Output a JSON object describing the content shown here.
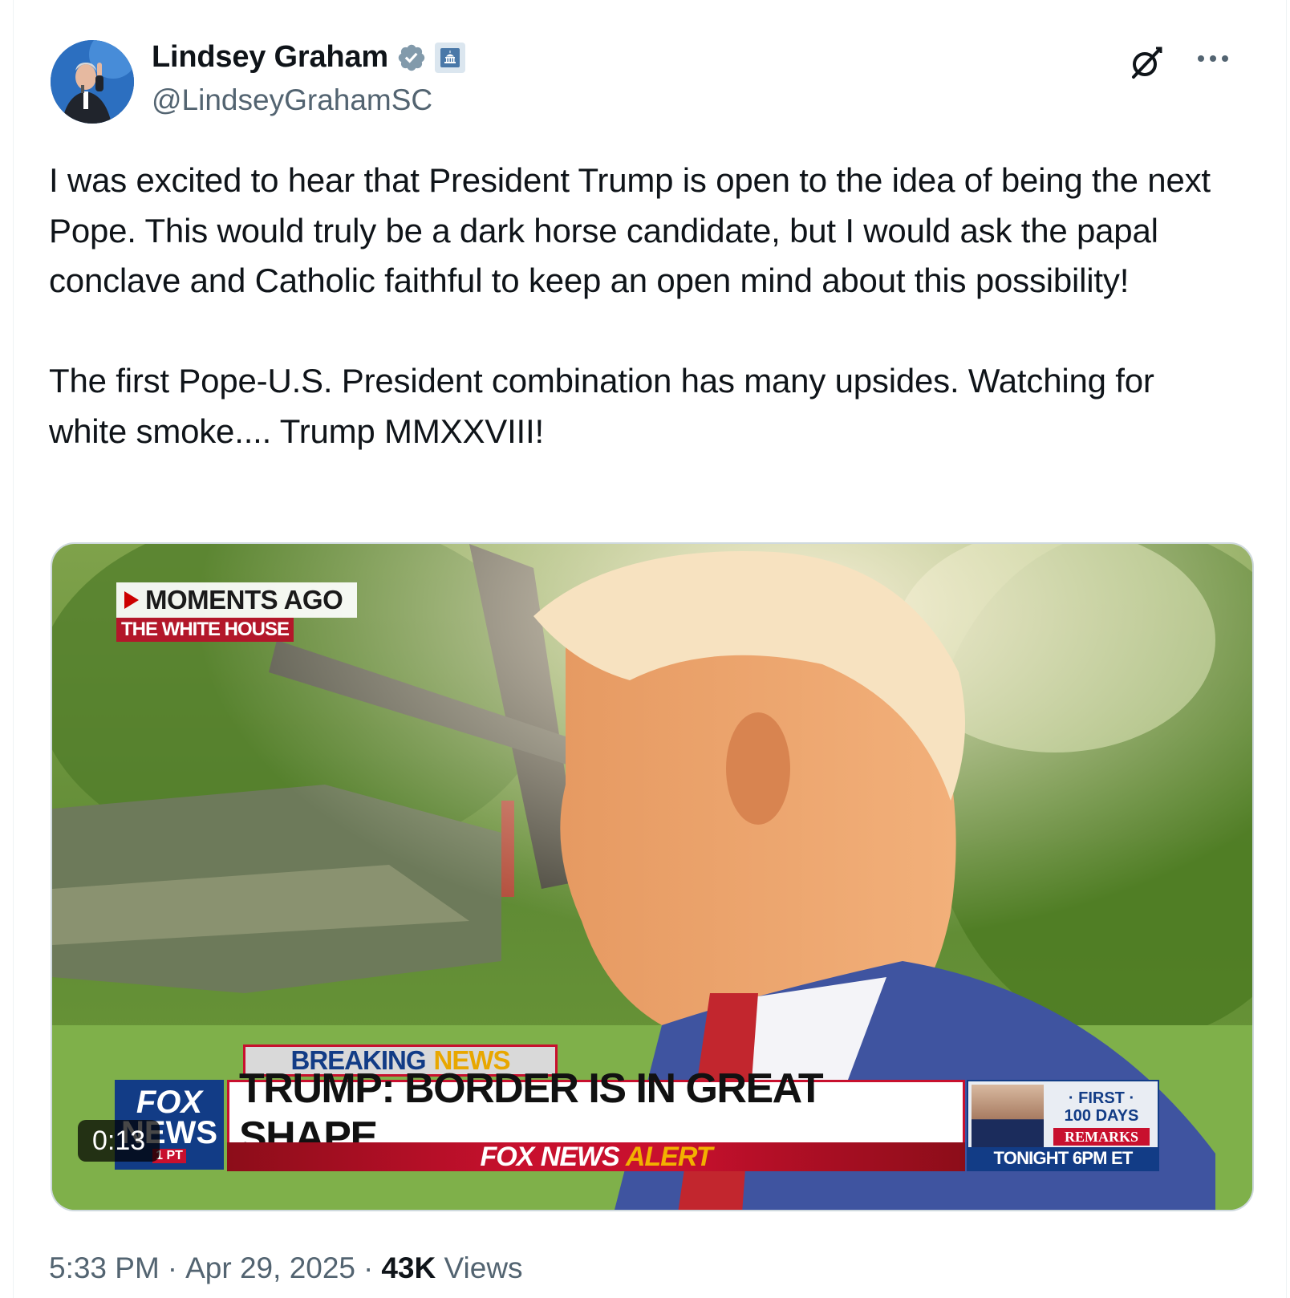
{
  "author": {
    "name": "Lindsey Graham",
    "handle": "@LindseyGrahamSC",
    "badges": [
      "verified-badge-icon",
      "government-badge-icon"
    ]
  },
  "header_actions": {
    "grok_icon": "grok-icon",
    "more_icon": "more-options-icon"
  },
  "tweet": {
    "text": "I was excited to hear that President Trump is open to the idea of being the next Pope. This would truly be a dark horse candidate, but I would ask the papal conclave and Catholic faithful to keep an open mind about this possibility!\n\nThe first Pope-U.S. President combination has many upsides. Watching for white smoke.... Trump MMXXVIII!"
  },
  "media": {
    "duration": "0:13",
    "overlay": {
      "moments_ago": "MOMENTS AGO",
      "location": "THE WHITE HOUSE",
      "breaking_1": "BREAKING",
      "breaking_2": "NEWS",
      "logo_line1": "FOX",
      "logo_line2": "NEWS",
      "logo_small": "1 PT",
      "headline": "TRUMP: BORDER IS IN GREAT SHAPE",
      "alert_1": "FOX NEWS",
      "alert_2": "ALERT",
      "promo_first": "· FIRST ·",
      "promo_days": "100 DAYS",
      "promo_remarks": "REMARKS",
      "promo_tonight": "TONIGHT 6PM ET"
    }
  },
  "footer": {
    "time": "5:33 PM",
    "separator": "·",
    "date": "Apr 29, 2025",
    "views_count": "43K",
    "views_label": "Views"
  },
  "colors": {
    "text_primary": "#0f1419",
    "text_secondary": "#536471",
    "verified": "#829aab",
    "fox_blue": "#123c86",
    "fox_red": "#c8102e"
  }
}
